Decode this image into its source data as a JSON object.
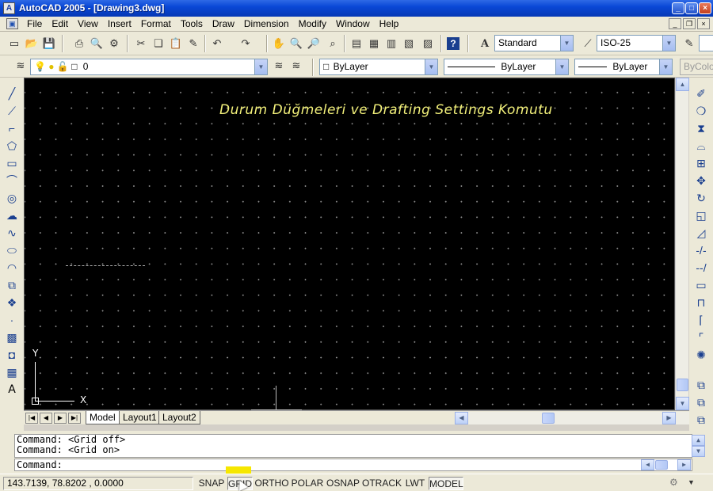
{
  "window": {
    "title": "AutoCAD 2005 - [Drawing3.dwg]",
    "app_icon": "autocad-app-icon",
    "controls": [
      "minimize",
      "maximize",
      "close"
    ]
  },
  "menubar": {
    "items": [
      "File",
      "Edit",
      "View",
      "Insert",
      "Format",
      "Tools",
      "Draw",
      "Dimension",
      "Modify",
      "Window",
      "Help"
    ]
  },
  "toolbar_standard": {
    "icons": [
      "new-icon",
      "open-icon",
      "save-icon",
      "print-icon",
      "preview-icon",
      "publish-icon",
      "cut-icon",
      "copy-icon",
      "paste-icon",
      "match-properties-icon",
      "undo-icon",
      "redo-icon",
      "pan-icon",
      "zoom-realtime-icon",
      "zoom-window-icon",
      "zoom-previous-icon",
      "properties-icon",
      "design-center-icon",
      "tool-palettes-icon",
      "sheet-set-icon",
      "markup-icon",
      "help-icon"
    ],
    "text_style": "Standard",
    "dim_style": "ISO-25"
  },
  "toolbar_layers": {
    "layer": "0",
    "color": "ByLayer",
    "linetype": "ByLayer",
    "lineweight": "ByLayer",
    "plotstyle": "ByColor"
  },
  "drawing": {
    "annotation": "Durum Düğmeleri ve Drafting Settings Komutu",
    "ucs_x": "X",
    "ucs_y": "Y"
  },
  "tabs": [
    "Model",
    "Layout1",
    "Layout2"
  ],
  "command": {
    "history": [
      "Command:  <Grid off>",
      "Command:  <Grid on>"
    ],
    "prompt": "Command:"
  },
  "status": {
    "coordinates": "143.7139, 78.8202 , 0.0000",
    "buttons": [
      "SNAP",
      "GRID",
      "ORTHO",
      "POLAR",
      "OSNAP",
      "OTRACK",
      "LWT",
      "MODEL"
    ],
    "highlighted": "GRID",
    "highlight_color": "#f6e700"
  }
}
